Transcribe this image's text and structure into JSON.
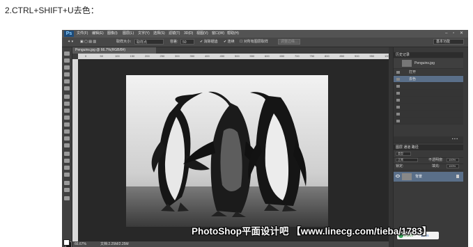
{
  "caption": "2.CTRL+SHIFT+U去色：",
  "photoshop": {
    "logo": "Ps",
    "menu": [
      "文件(F)",
      "编辑(E)",
      "图像(I)",
      "图层(L)",
      "文字(Y)",
      "选择(S)",
      "滤镜(T)",
      "3D(D)",
      "视图(V)",
      "窗口(W)",
      "帮助(H)"
    ],
    "window_controls": "– ▫ ✕",
    "options": {
      "sample_size_label": "取样大小:",
      "sample_size_value": "取样点",
      "tolerance_label": "容差:",
      "tolerance_value": "50",
      "anti_alias": "消除锯齿",
      "contiguous": "连续",
      "sample_all_layers": "对所有图层取样",
      "refine_edge": "调整边缘...",
      "workspace": "基本功能"
    },
    "document_tab": "Penguins.jpg @ 66.7%(RGB/8#)",
    "ruler_ticks": [
      "0",
      "50",
      "100",
      "150",
      "200",
      "250",
      "300",
      "350",
      "400",
      "450",
      "500",
      "550",
      "600",
      "650",
      "700",
      "750",
      "800",
      "850",
      "900",
      "950",
      "1000"
    ],
    "status": {
      "zoom": "66.67%",
      "doc_info": "文档:2.25M/2.25M"
    },
    "history": {
      "title": "历史记录",
      "snapshot": "Penguins.jpg",
      "rows": [
        "打开",
        "去色",
        "",
        "",
        "",
        "",
        "",
        ""
      ]
    },
    "layers": {
      "tabs": "图层  通道  路径",
      "kind_label": "类型",
      "blend_mode": "正常",
      "opacity_label": "不透明度:",
      "opacity_value": "100%",
      "lock_label": "锁定:",
      "fill_label": "填充:",
      "fill_value": "100%",
      "layer_name": "背景"
    },
    "net_badge": {
      "up": "0.1K/s",
      "down": "10K/s"
    }
  },
  "watermark": "PhotoShop平面设计吧 【www.linecg.com/tieba/1783】"
}
